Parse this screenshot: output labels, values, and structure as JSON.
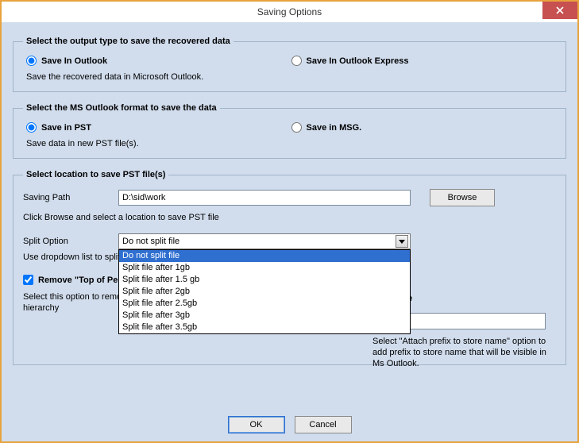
{
  "window": {
    "title": "Saving Options"
  },
  "group_output": {
    "legend": "Select the output type to save the recovered data",
    "opt1_label": "Save In Outlook",
    "opt2_label": "Save In Outlook Express",
    "desc": "Save the recovered data in Microsoft Outlook."
  },
  "group_format": {
    "legend": "Select the MS Outlook format to save the data",
    "opt1_label": "Save in PST",
    "opt2_label": "Save in MSG.",
    "desc": "Save data in new PST file(s)."
  },
  "group_location": {
    "legend": "Select location to save PST file(s)",
    "path_label": "Saving Path",
    "path_value": "D:\\sid\\work",
    "browse_label": "Browse",
    "path_hint": "Click Browse and select a location to save PST file",
    "split_label": "Split Option",
    "split_selected": "Do not split file",
    "split_options": [
      "Do not split file",
      "Split file after 1gb",
      "Split file after 1.5 gb",
      "Split file after 2gb",
      "Split file after 2.5gb",
      "Split file after 3gb",
      "Split file after 3.5gb"
    ],
    "split_hint_partial": "Use dropdown list to split t",
    "remove_top_label": "Remove \"Top of Pers",
    "remove_help_partial": "Select this option to remov\nhierarchy",
    "right_title_fragment": "ore Name",
    "right_input_fragment": "efix",
    "right_help": "Select \"Attach prefix to store name\" option to add prefix to store name that will be visible in Ms Outlook."
  },
  "buttons": {
    "ok": "OK",
    "cancel": "Cancel"
  }
}
